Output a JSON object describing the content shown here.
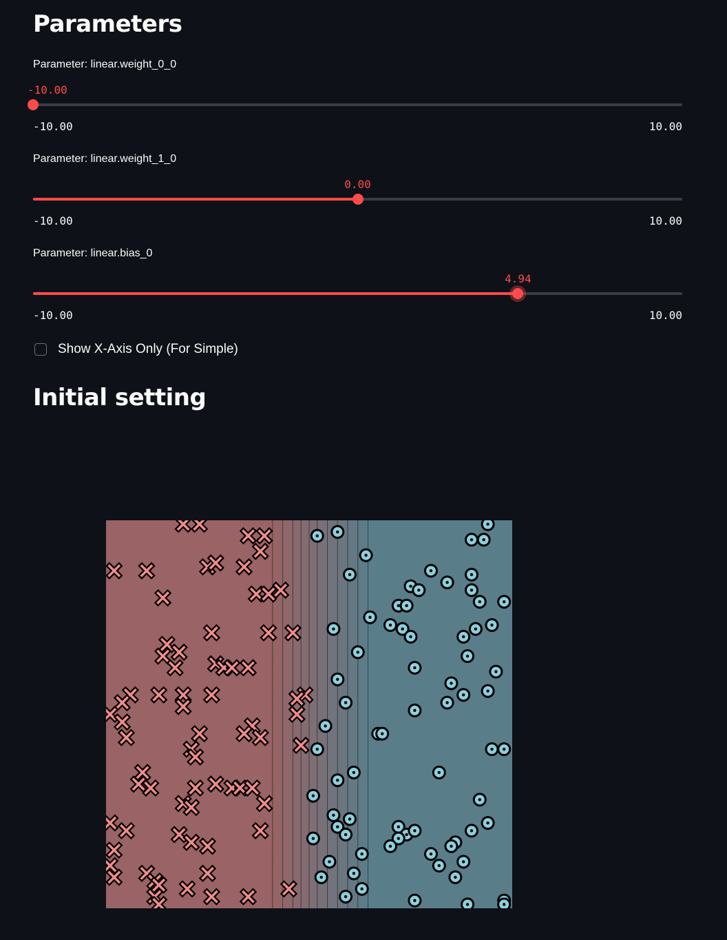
{
  "headings": {
    "parameters": "Parameters",
    "initial_setting": "Initial setting"
  },
  "sliders": [
    {
      "label": "Parameter: linear.weight_0_0",
      "value": -10.0,
      "value_text": "-10.00",
      "min": -10.0,
      "max": 10.0,
      "min_text": "-10.00",
      "max_text": "10.00"
    },
    {
      "label": "Parameter: linear.weight_1_0",
      "value": 0.0,
      "value_text": "0.00",
      "min": -10.0,
      "max": 10.0,
      "min_text": "-10.00",
      "max_text": "10.00"
    },
    {
      "label": "Parameter: linear.bias_0",
      "value": 4.94,
      "value_text": "4.94",
      "min": -10.0,
      "max": 10.0,
      "min_text": "-10.00",
      "max_text": "10.00"
    }
  ],
  "checkbox": {
    "label": "Show X-Axis Only (For Simple)",
    "checked": false
  },
  "colors": {
    "accent": "#ff4b4b",
    "background": "#0e1117",
    "class_x_region": "#9a6365",
    "class_o_region": "#5a7d8a",
    "class_x_marker": "#f08c8c",
    "class_o_marker": "#8ecfdc"
  },
  "chart_data": {
    "type": "scatter",
    "title": "",
    "xlabel": "",
    "ylabel": "",
    "xlim": [
      0,
      1
    ],
    "ylim": [
      0,
      1
    ],
    "decision_boundaries_x": [
      0.41,
      0.435,
      0.46,
      0.48,
      0.5,
      0.52,
      0.545,
      0.57,
      0.595,
      0.62,
      0.645
    ],
    "series": [
      {
        "marker": "x",
        "points": [
          [
            0.19,
            0.99
          ],
          [
            0.23,
            0.99
          ],
          [
            0.35,
            0.96
          ],
          [
            0.39,
            0.96
          ],
          [
            0.38,
            0.92
          ],
          [
            0.02,
            0.87
          ],
          [
            0.1,
            0.87
          ],
          [
            0.25,
            0.88
          ],
          [
            0.27,
            0.89
          ],
          [
            0.34,
            0.88
          ],
          [
            0.37,
            0.81
          ],
          [
            0.4,
            0.81
          ],
          [
            0.43,
            0.82
          ],
          [
            0.14,
            0.8
          ],
          [
            0.26,
            0.71
          ],
          [
            0.4,
            0.71
          ],
          [
            0.46,
            0.71
          ],
          [
            0.15,
            0.68
          ],
          [
            0.18,
            0.66
          ],
          [
            0.14,
            0.65
          ],
          [
            0.17,
            0.62
          ],
          [
            0.27,
            0.63
          ],
          [
            0.29,
            0.62
          ],
          [
            0.31,
            0.62
          ],
          [
            0.35,
            0.62
          ],
          [
            0.06,
            0.55
          ],
          [
            0.19,
            0.55
          ],
          [
            0.26,
            0.55
          ],
          [
            0.04,
            0.53
          ],
          [
            0.13,
            0.55
          ],
          [
            0.49,
            0.55
          ],
          [
            0.01,
            0.5
          ],
          [
            0.04,
            0.48
          ],
          [
            0.19,
            0.52
          ],
          [
            0.47,
            0.54
          ],
          [
            0.47,
            0.5
          ],
          [
            0.36,
            0.47
          ],
          [
            0.34,
            0.45
          ],
          [
            0.38,
            0.44
          ],
          [
            0.05,
            0.44
          ],
          [
            0.23,
            0.45
          ],
          [
            0.21,
            0.41
          ],
          [
            0.22,
            0.39
          ],
          [
            0.48,
            0.42
          ],
          [
            0.09,
            0.35
          ],
          [
            0.08,
            0.32
          ],
          [
            0.11,
            0.31
          ],
          [
            0.22,
            0.31
          ],
          [
            0.27,
            0.32
          ],
          [
            0.31,
            0.31
          ],
          [
            0.33,
            0.31
          ],
          [
            0.36,
            0.31
          ],
          [
            0.19,
            0.27
          ],
          [
            0.21,
            0.26
          ],
          [
            0.39,
            0.27
          ],
          [
            0.01,
            0.22
          ],
          [
            0.05,
            0.2
          ],
          [
            0.18,
            0.19
          ],
          [
            0.38,
            0.2
          ],
          [
            0.02,
            0.15
          ],
          [
            0.21,
            0.17
          ],
          [
            0.25,
            0.16
          ],
          [
            0.01,
            0.11
          ],
          [
            0.02,
            0.08
          ],
          [
            0.1,
            0.09
          ],
          [
            0.25,
            0.09
          ],
          [
            0.12,
            0.07
          ],
          [
            0.13,
            0.06
          ],
          [
            0.2,
            0.05
          ],
          [
            0.26,
            0.03
          ],
          [
            0.35,
            0.03
          ],
          [
            0.45,
            0.05
          ],
          [
            0.12,
            0.03
          ],
          [
            0.13,
            0.01
          ]
        ]
      },
      {
        "marker": "o",
        "points": [
          [
            0.52,
            0.96
          ],
          [
            0.57,
            0.97
          ],
          [
            0.94,
            0.99
          ],
          [
            0.9,
            0.95
          ],
          [
            0.93,
            0.95
          ],
          [
            0.64,
            0.91
          ],
          [
            0.6,
            0.86
          ],
          [
            0.8,
            0.87
          ],
          [
            0.84,
            0.84
          ],
          [
            0.9,
            0.86
          ],
          [
            0.75,
            0.83
          ],
          [
            0.77,
            0.82
          ],
          [
            0.9,
            0.82
          ],
          [
            0.72,
            0.78
          ],
          [
            0.74,
            0.78
          ],
          [
            0.92,
            0.79
          ],
          [
            0.98,
            0.79
          ],
          [
            0.65,
            0.75
          ],
          [
            0.7,
            0.73
          ],
          [
            0.56,
            0.72
          ],
          [
            0.73,
            0.72
          ],
          [
            0.75,
            0.7
          ],
          [
            0.88,
            0.7
          ],
          [
            0.91,
            0.72
          ],
          [
            0.95,
            0.73
          ],
          [
            0.62,
            0.66
          ],
          [
            0.76,
            0.62
          ],
          [
            0.89,
            0.65
          ],
          [
            0.57,
            0.59
          ],
          [
            0.85,
            0.58
          ],
          [
            0.96,
            0.61
          ],
          [
            0.94,
            0.56
          ],
          [
            0.84,
            0.53
          ],
          [
            0.88,
            0.55
          ],
          [
            0.59,
            0.53
          ],
          [
            0.76,
            0.51
          ],
          [
            0.54,
            0.47
          ],
          [
            0.67,
            0.45
          ],
          [
            0.68,
            0.45
          ],
          [
            0.52,
            0.41
          ],
          [
            0.95,
            0.41
          ],
          [
            0.98,
            0.41
          ],
          [
            0.82,
            0.35
          ],
          [
            0.61,
            0.35
          ],
          [
            0.57,
            0.33
          ],
          [
            0.51,
            0.29
          ],
          [
            0.92,
            0.28
          ],
          [
            0.56,
            0.24
          ],
          [
            0.6,
            0.23
          ],
          [
            0.57,
            0.21
          ],
          [
            0.59,
            0.19
          ],
          [
            0.72,
            0.21
          ],
          [
            0.74,
            0.19
          ],
          [
            0.76,
            0.2
          ],
          [
            0.72,
            0.18
          ],
          [
            0.94,
            0.22
          ],
          [
            0.9,
            0.2
          ],
          [
            0.86,
            0.17
          ],
          [
            0.51,
            0.18
          ],
          [
            0.7,
            0.16
          ],
          [
            0.8,
            0.14
          ],
          [
            0.85,
            0.16
          ],
          [
            0.55,
            0.12
          ],
          [
            0.63,
            0.14
          ],
          [
            0.82,
            0.11
          ],
          [
            0.88,
            0.12
          ],
          [
            0.61,
            0.09
          ],
          [
            0.53,
            0.08
          ],
          [
            0.63,
            0.05
          ],
          [
            0.86,
            0.08
          ],
          [
            0.59,
            0.03
          ],
          [
            0.76,
            0.02
          ],
          [
            0.89,
            0.01
          ],
          [
            0.98,
            0.02
          ],
          [
            0.98,
            0.01
          ]
        ]
      }
    ]
  }
}
